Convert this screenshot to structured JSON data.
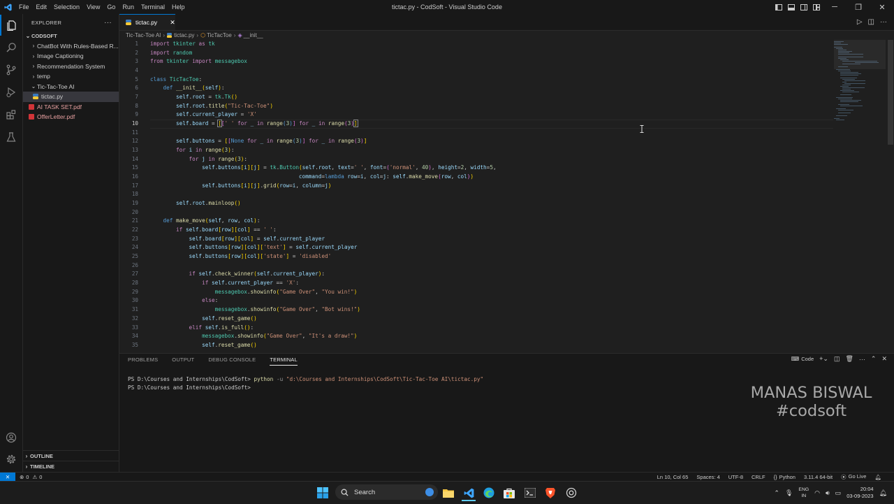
{
  "window": {
    "title": "tictac.py - CodSoft - Visual Studio Code",
    "menus": [
      "File",
      "Edit",
      "Selection",
      "View",
      "Go",
      "Run",
      "Terminal",
      "Help"
    ]
  },
  "explorer": {
    "header": "EXPLORER",
    "root": "CODSOFT",
    "items": [
      {
        "label": "ChatBot With Rules-Based R...",
        "type": "folder",
        "expanded": false
      },
      {
        "label": "Image Captioning",
        "type": "folder",
        "expanded": false
      },
      {
        "label": "Recommendation System",
        "type": "folder",
        "expanded": false
      },
      {
        "label": "temp",
        "type": "folder",
        "expanded": false
      },
      {
        "label": "Tic-Tac-Toe AI",
        "type": "folder",
        "expanded": true
      },
      {
        "label": "tictac.py",
        "type": "python-file",
        "selected": true
      },
      {
        "label": "AI TASK SET.pdf",
        "type": "pdf-file"
      },
      {
        "label": "OfferLetter.pdf",
        "type": "pdf-file"
      }
    ],
    "outline": "OUTLINE",
    "timeline": "TIMELINE"
  },
  "tab": {
    "label": "tictac.py"
  },
  "breadcrumb": [
    "Tic-Tac-Toe AI",
    "tictac.py",
    "TicTacToe",
    "__init__"
  ],
  "editor": {
    "current_line": 10,
    "line_numbers": [
      "1",
      "2",
      "3",
      "4",
      "5",
      "6",
      "7",
      "8",
      "9",
      "10",
      "11",
      "12",
      "13",
      "14",
      "15",
      "16",
      "17",
      "18",
      "19",
      "20",
      "21",
      "22",
      "23",
      "24",
      "25",
      "26",
      "27",
      "28",
      "29",
      "30",
      "31",
      "32",
      "33",
      "34",
      "35"
    ]
  },
  "panel": {
    "tabs": [
      "PROBLEMS",
      "OUTPUT",
      "DEBUG CONSOLE",
      "TERMINAL"
    ],
    "active_tab": "TERMINAL",
    "terminal_profile": "Code",
    "terminal_prompt": "PS D:\\Courses and Internships\\CodSoft>",
    "terminal_cmd": "python",
    "terminal_flag": "-u",
    "terminal_arg": "\"d:\\Courses and Internships\\CodSoft\\Tic-Tac-Toe AI\\tictac.py\"",
    "watermark_name": "MANAS BISWAL",
    "watermark_tag": "#codsoft"
  },
  "statusbar": {
    "errors": "0",
    "warnings": "0",
    "position": "Ln 10, Col 65",
    "indent": "Spaces: 4",
    "encoding": "UTF-8",
    "eol": "CRLF",
    "language": "Python",
    "interpreter": "3.11.4 64-bit",
    "golive": "Go Live"
  },
  "taskbar": {
    "search": "Search",
    "lang": "ENG",
    "region": "IN",
    "time": "20:04",
    "date": "03-09-2023"
  }
}
